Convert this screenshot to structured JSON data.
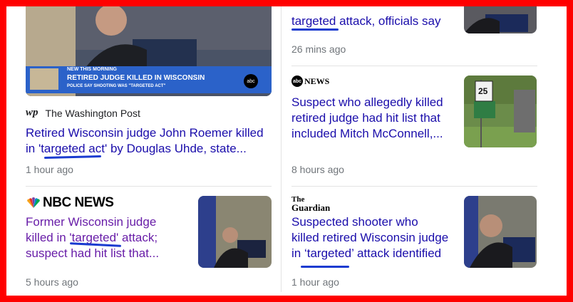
{
  "left": {
    "card1": {
      "thumb_banner_top": "NEW THIS MORNING",
      "thumb_banner_main": "RETIRED JUDGE KILLED IN WISCONSIN",
      "thumb_banner_sub": "POLICE SAY SHOOTING WAS \"TARGETED ACT\"",
      "thumb_logo": "abc",
      "source_icon": "wp",
      "source": "The Washington Post",
      "headline_l1": "Retired Wisconsin judge John Roemer killed",
      "headline_l2": "in 'targeted act' by Douglas Uhde, state...",
      "time": "1 hour ago"
    },
    "card2": {
      "source_logo": "NBC NEWS",
      "headline_l1": "Former Wisconsin judge",
      "headline_l2": "killed in 'targeted' attack;",
      "headline_l3": "suspect had hit list that...",
      "time": "5 hours ago"
    }
  },
  "right": {
    "card0": {
      "headline": "targeted attack, officials say",
      "time": "26 mins ago"
    },
    "card1": {
      "source_logo_disc": "abc",
      "source_logo_text": "NEWS",
      "headline_l1": "Suspect who allegedly killed",
      "headline_l2": "retired judge had hit list that",
      "headline_l3": "included Mitch McConnell,...",
      "sign_text": "25",
      "time": "8 hours ago"
    },
    "card2": {
      "source_logo_l1": "The",
      "source_logo_l2": "Guardian",
      "headline_l1": "Suspected shooter who",
      "headline_l2": "killed retired Wisconsin judge",
      "headline_l3": "in ‘targeted’ attack identified",
      "time": "1 hour ago"
    }
  },
  "colors": {
    "frame": "#ff0000",
    "link": "#1a0dab",
    "visited": "#681da8",
    "annotation": "#1a3bd0",
    "meta": "#70757a"
  }
}
